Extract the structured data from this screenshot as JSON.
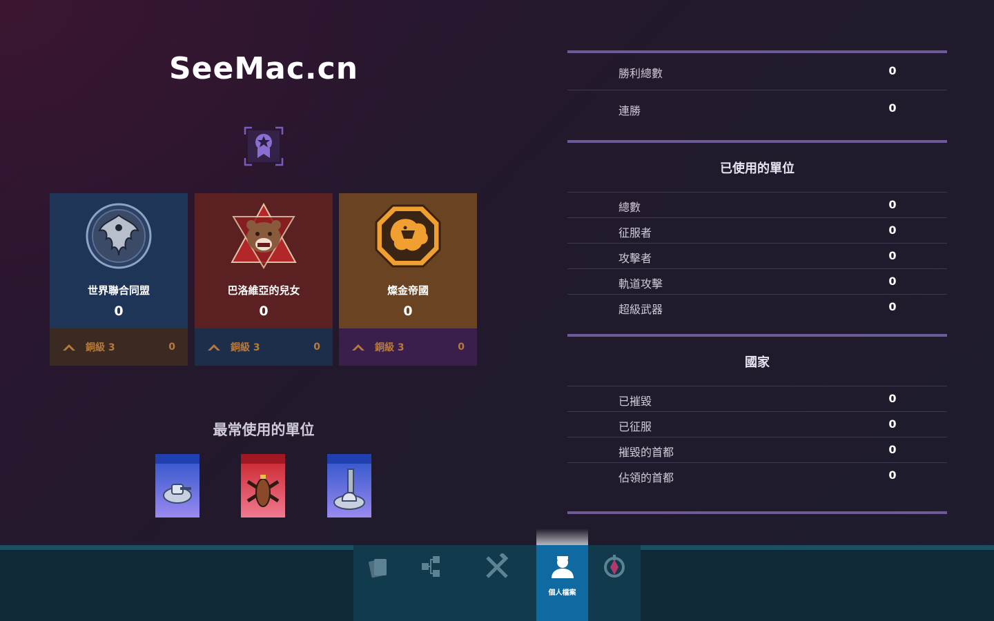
{
  "profile": {
    "player_name": "SeeMac.cn",
    "badge_icon": "ribbon-star-icon"
  },
  "factions": [
    {
      "name": "世界聯合同盟",
      "score": "0",
      "rank_label": "銅級 3",
      "rank_value": "0",
      "emblem_icon": "eagle-emblem-icon",
      "color": "#1e3558"
    },
    {
      "name": "巴洛維亞的兒女",
      "score": "0",
      "rank_label": "銅級 3",
      "rank_value": "0",
      "emblem_icon": "bear-emblem-icon",
      "color": "#5a2022"
    },
    {
      "name": "燦金帝國",
      "score": "0",
      "rank_label": "銅級 3",
      "rank_value": "0",
      "emblem_icon": "dragon-emblem-icon",
      "color": "#6a4422"
    }
  ],
  "most_used": {
    "title": "最常使用的單位",
    "units": [
      {
        "icon": "tank-unit-icon"
      },
      {
        "icon": "gunship-unit-icon"
      },
      {
        "icon": "turret-unit-icon"
      }
    ]
  },
  "stats": {
    "general": [
      {
        "label": "勝利總數",
        "value": "0"
      },
      {
        "label": "連勝",
        "value": "0"
      }
    ],
    "units_used": {
      "title": "已使用的單位",
      "rows": [
        {
          "label": "總數",
          "value": "0"
        },
        {
          "label": "征服者",
          "value": "0"
        },
        {
          "label": "攻擊者",
          "value": "0"
        },
        {
          "label": "軌道攻擊",
          "value": "0"
        },
        {
          "label": "超級武器",
          "value": "0"
        }
      ]
    },
    "nations": {
      "title": "國家",
      "rows": [
        {
          "label": "已摧毀",
          "value": "0"
        },
        {
          "label": "已征服",
          "value": "0"
        },
        {
          "label": "摧毀的首都",
          "value": "0"
        },
        {
          "label": "佔領的首都",
          "value": "0"
        }
      ]
    }
  },
  "nav": {
    "items": [
      {
        "icon": "cards-icon"
      },
      {
        "icon": "tech-tree-icon"
      },
      {
        "icon": "crossed-swords-icon"
      },
      {
        "icon": "profile-icon",
        "label": "個人檔案",
        "active": true
      },
      {
        "icon": "compass-icon"
      }
    ]
  },
  "colors": {
    "accent_divider": "#6e5a98",
    "nav_active": "#0e6aa0",
    "rank_text": "#b87a3a"
  }
}
